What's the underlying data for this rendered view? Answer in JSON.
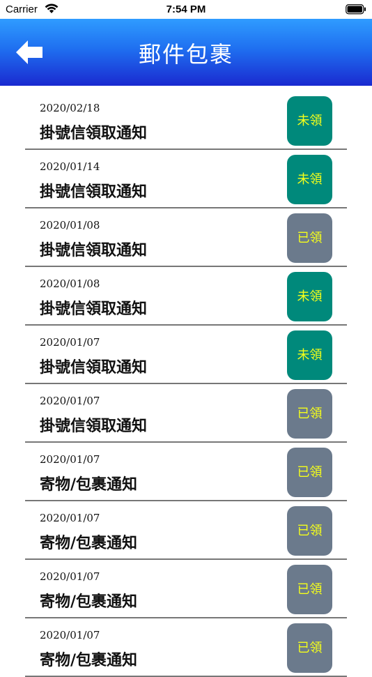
{
  "status_bar": {
    "carrier": "Carrier",
    "time": "7:54 PM"
  },
  "header": {
    "title": "郵件包裹",
    "back_icon": "back-arrow-icon"
  },
  "colors": {
    "unclaimed": "#00897b",
    "claimed": "#6b7a8c",
    "badge_text": "#f5ff1a"
  },
  "items": [
    {
      "date": "2020/02/18",
      "title": "掛號信領取通知",
      "status": "未領",
      "claimed": false
    },
    {
      "date": "2020/01/14",
      "title": "掛號信領取通知",
      "status": "未領",
      "claimed": false
    },
    {
      "date": "2020/01/08",
      "title": "掛號信領取通知",
      "status": "已領",
      "claimed": true
    },
    {
      "date": "2020/01/08",
      "title": "掛號信領取通知",
      "status": "未領",
      "claimed": false
    },
    {
      "date": "2020/01/07",
      "title": "掛號信領取通知",
      "status": "未領",
      "claimed": false
    },
    {
      "date": "2020/01/07",
      "title": "掛號信領取通知",
      "status": "已領",
      "claimed": true
    },
    {
      "date": "2020/01/07",
      "title": "寄物/包裹通知",
      "status": "已領",
      "claimed": true
    },
    {
      "date": "2020/01/07",
      "title": "寄物/包裹通知",
      "status": "已領",
      "claimed": true
    },
    {
      "date": "2020/01/07",
      "title": "寄物/包裹通知",
      "status": "已領",
      "claimed": true
    },
    {
      "date": "2020/01/07",
      "title": "寄物/包裹通知",
      "status": "已領",
      "claimed": true
    }
  ]
}
